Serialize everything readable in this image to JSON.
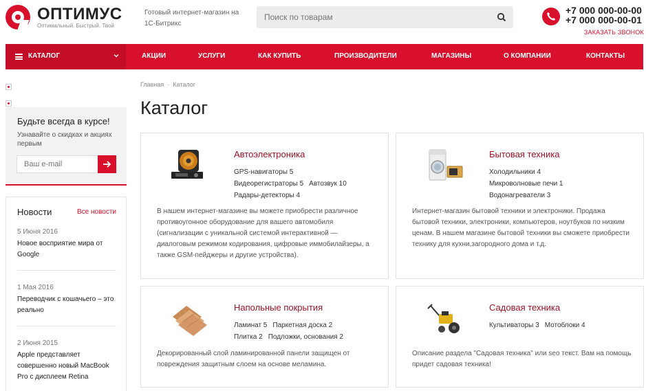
{
  "header": {
    "logo_name": "ОПТИМУС",
    "logo_slogan": "Оптимальный. Быстрый. Твой",
    "description": "Готовый интернет-магазин на 1С-Битрикс",
    "search_placeholder": "Поиск по товарам",
    "phone_1": "+7 000 000-00-00",
    "phone_2": "+7 000 000-00-01",
    "callback": "ЗАКАЗАТЬ ЗВОНОК"
  },
  "nav": {
    "catalog": "КАТАЛОГ",
    "items": [
      "АКЦИИ",
      "УСЛУГИ",
      "КАК КУПИТЬ",
      "ПРОИЗВОДИТЕЛИ",
      "МАГАЗИНЫ",
      "О КОМПАНИИ",
      "КОНТАКТЫ"
    ]
  },
  "sidebar": {
    "subscribe_title": "Будьте всегда в курсе!",
    "subscribe_text": "Узнавайте о скидках и акциях первым",
    "email_placeholder": "Ваш e-mail",
    "news_title": "Новости",
    "news_all": "Все новости",
    "news": [
      {
        "date": "5 Июня 2016",
        "text": "Новое восприятие мира от Google"
      },
      {
        "date": "1 Мая 2016",
        "text": "Переводчик с кошачьего – это реально"
      },
      {
        "date": "2 Июня 2015",
        "text": "Apple представляет совершенно новый MacBook Pro с дисплеем Retina"
      }
    ]
  },
  "breadcrumb": {
    "home": "Главная",
    "sep": "-",
    "current": "Каталог"
  },
  "page_title": "Каталог",
  "cards": [
    {
      "title": "Автоэлектроника",
      "links": [
        [
          "GPS-навигаторы 5"
        ],
        [
          "Видеорегистраторы 5",
          "Автозвук 10"
        ],
        [
          "Радары-детекторы 4"
        ]
      ],
      "description": "В нашем интернет-магазине вы можете приобрести различное противоугонное оборудование для вашего автомобиля (сигнализации с уникальной системой интерактивной — диалоговым режимом кодирования, цифровые иммобилайзеры, а также GSM-пейджеры и другие устройства).",
      "icon": "car-speaker-icon"
    },
    {
      "title": "Бытовая техника",
      "links": [
        [
          "Холодильники 4"
        ],
        [
          "Микроволновые печи 1"
        ],
        [
          "Водонагреватели 3"
        ]
      ],
      "description": "Интернет-магазин бытовой техники и электроники. Продажа бытовой техники, электроники, компьютеров, ноутбуков по низким ценам. В нашем магазине бытовой техники вы сможете приобрести технику для кухни,загородного дома и т.д.",
      "icon": "washing-machine-icon"
    },
    {
      "title": "Напольные покрытия",
      "links": [
        [
          "Ламинат 5",
          "Паркетная доска 2"
        ],
        [
          "Плитка 2",
          "Подложки, основания 2"
        ]
      ],
      "description": "Декорированный слой ламинированной панели защищен от повреждения защитным слоем на основе меламина.",
      "icon": "flooring-icon"
    },
    {
      "title": "Садовая техника",
      "links": [
        [
          "Культиваторы 3",
          "Мотоблоки 4"
        ]
      ],
      "description": "Описание раздела \"Садовая техника\" или seo текст. Вам на помощь придет садовая техника!",
      "icon": "cultivator-icon"
    }
  ],
  "colors": {
    "accent": "#d8102b",
    "title": "#a01125"
  }
}
